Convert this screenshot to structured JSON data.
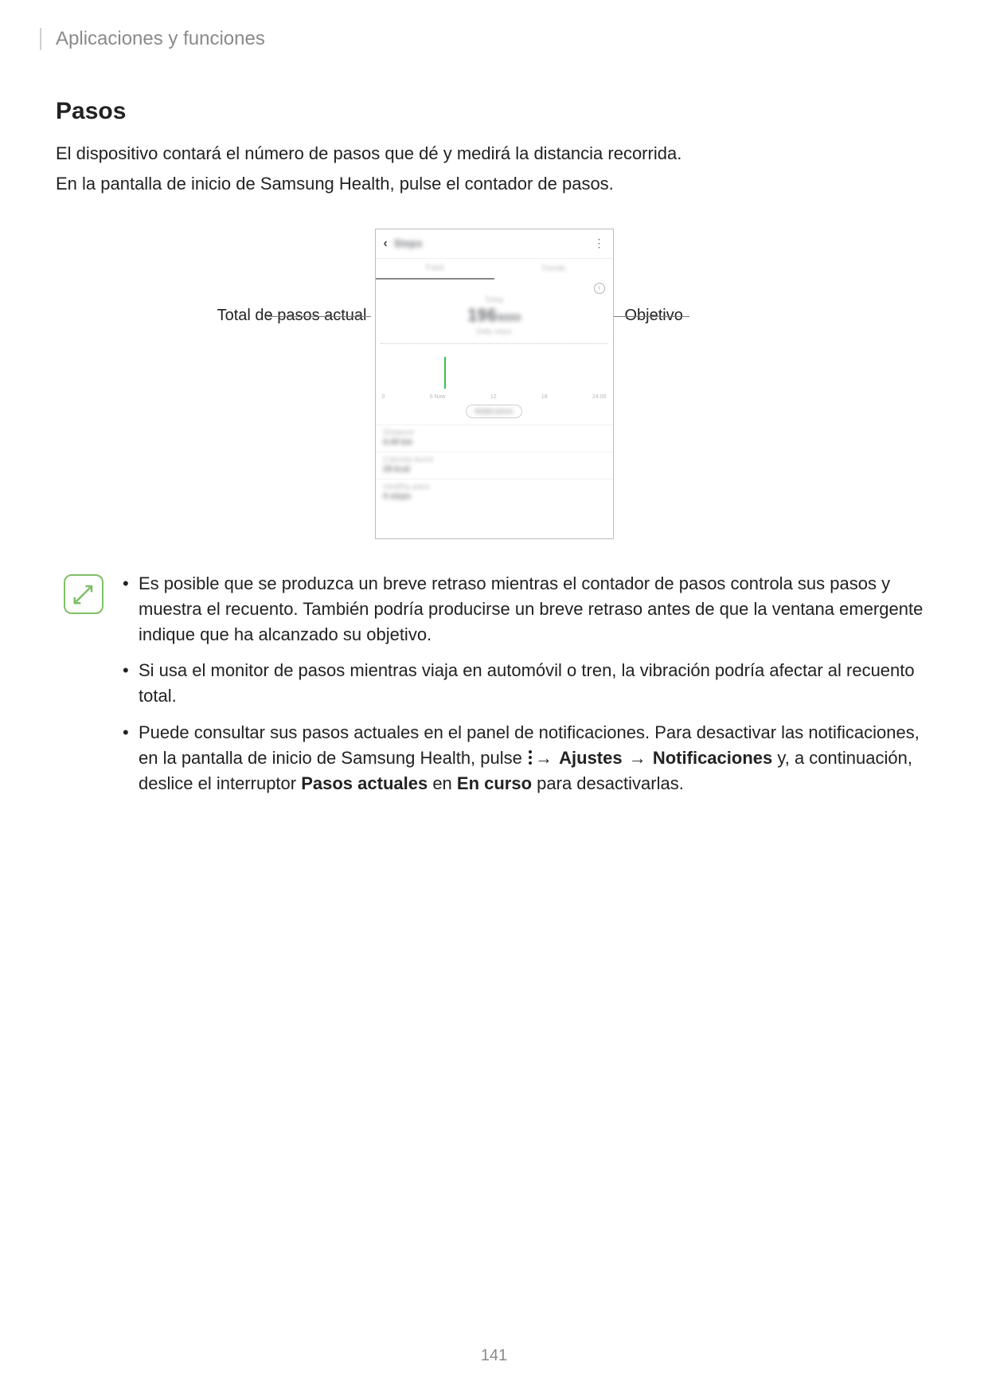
{
  "header": {
    "breadcrumb": "Aplicaciones y funciones"
  },
  "section": {
    "title": "Pasos",
    "p1": "El dispositivo contará el número de pasos que dé y medirá la distancia recorrida.",
    "p2": "En la pantalla de inicio de Samsung Health, pulse el contador de pasos."
  },
  "callouts": {
    "left": "Total de pasos actual",
    "right": "Objetivo"
  },
  "phone": {
    "title": "Steps",
    "tab1": "Track",
    "tab2": "Trends",
    "today": "Today",
    "bignum": "196",
    "bignum_suffix": "/6000",
    "daily": "Daily steps",
    "axis": [
      "0",
      "6  Now",
      "12",
      "18",
      "24:00"
    ],
    "chip": "Mobile phone",
    "rows": [
      {
        "label": "Distance",
        "value": "0.49 km"
      },
      {
        "label": "Calories burnt",
        "value": "29 kcal"
      },
      {
        "label": "Healthy pace",
        "value": "0 steps"
      }
    ]
  },
  "notes": {
    "n1": "Es posible que se produzca un breve retraso mientras el contador de pasos controla sus pasos y muestra el recuento. También podría producirse un breve retraso antes de que la ventana emergente indique que ha alcanzado su objetivo.",
    "n2": "Si usa el monitor de pasos mientras viaja en automóvil o tren, la vibración podría afectar al recuento total.",
    "n3a": "Puede consultar sus pasos actuales en el panel de notificaciones. Para desactivar las notificaciones, en la pantalla de inicio de Samsung Health, pulse ",
    "n3_ajustes": "Ajustes",
    "n3b": " ",
    "n3_notif": "Notificaciones",
    "n3c": " y, a continuación, deslice el interruptor ",
    "n3_pasos": "Pasos actuales",
    "n3d": " en ",
    "n3_curso": "En curso",
    "n3e": " para desactivarlas."
  },
  "pageNumber": "141"
}
